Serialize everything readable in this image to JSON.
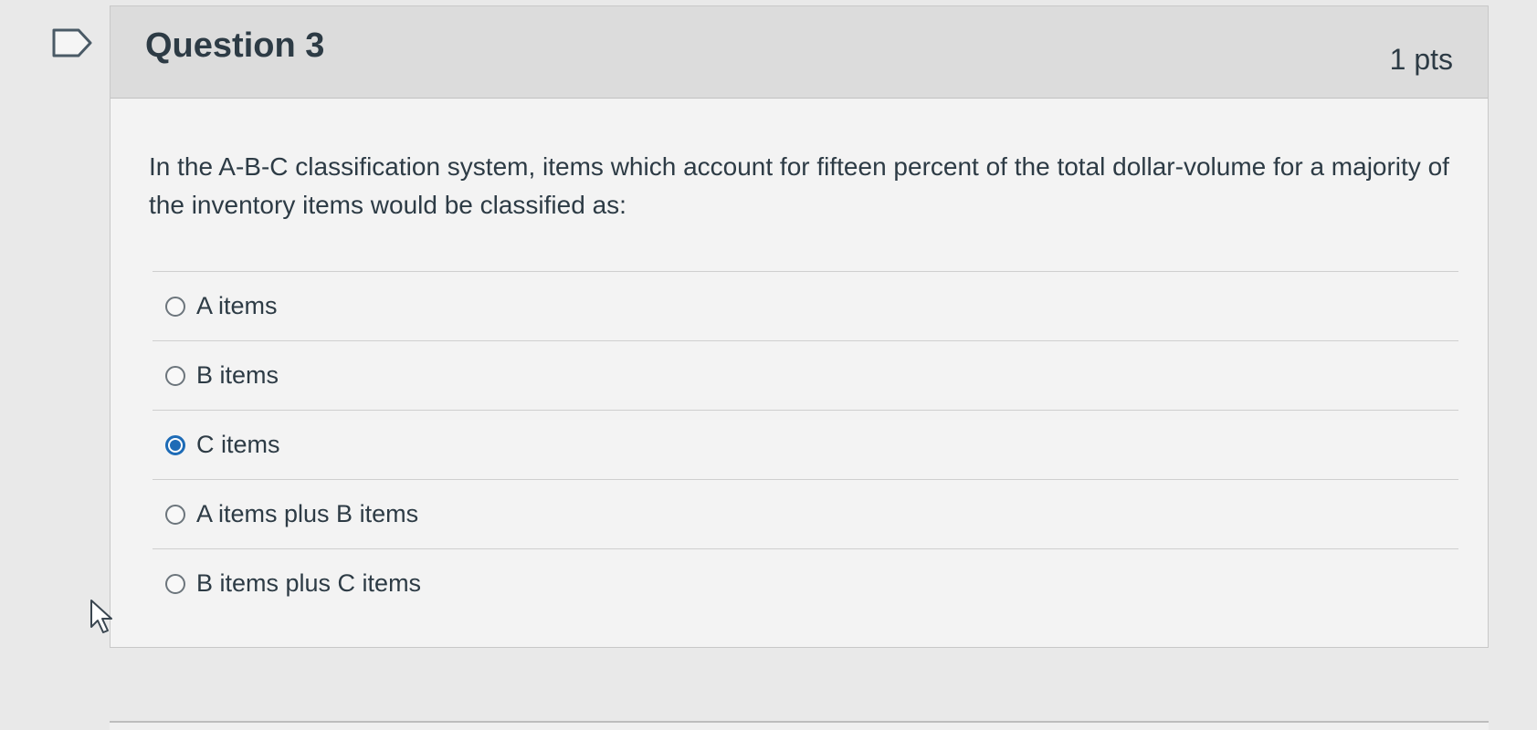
{
  "question": {
    "title": "Question 3",
    "points": "1 pts",
    "text": "In the A-B-C classification system, items which account for fifteen percent of the total dollar-volume for a majority of the inventory items would be classified as:"
  },
  "answers": [
    {
      "label": "A items",
      "selected": false
    },
    {
      "label": "B items",
      "selected": false
    },
    {
      "label": "C items",
      "selected": true
    },
    {
      "label": "A items plus B items",
      "selected": false
    },
    {
      "label": "B items plus C items",
      "selected": false
    }
  ],
  "colors": {
    "accent": "#1d6bb6",
    "header_bg": "#dcdcdc",
    "text": "#2d3b45"
  },
  "icons": {
    "flag": "flag-question-icon",
    "cursor": "mouse-pointer-icon"
  }
}
